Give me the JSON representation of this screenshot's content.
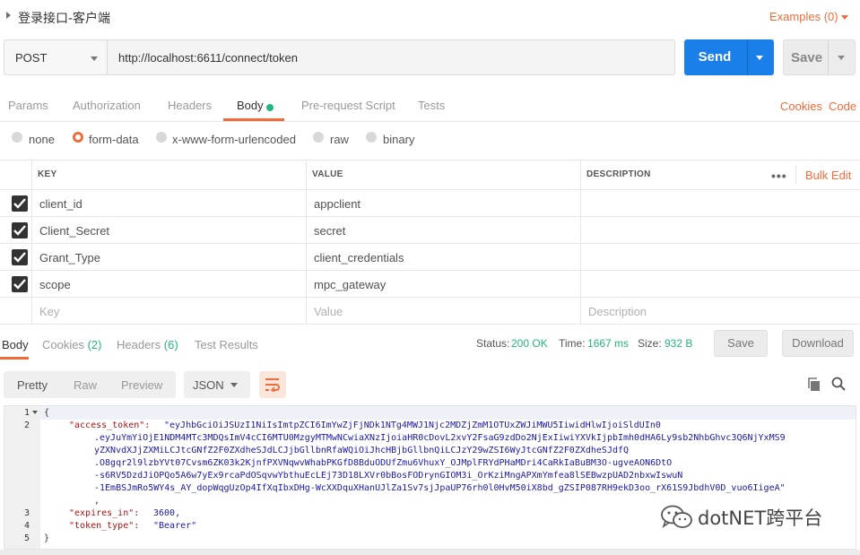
{
  "request": {
    "title": "登录接口-客户端",
    "examples_label": "Examples (0)",
    "method": "POST",
    "url": "http://localhost:6611/connect/token",
    "send_label": "Send",
    "save_label": "Save"
  },
  "tabs": {
    "items": [
      "Params",
      "Authorization",
      "Headers",
      "Body",
      "Pre-request Script",
      "Tests"
    ],
    "active": "Body",
    "cookies_label": "Cookies",
    "code_label": "Code"
  },
  "body_types": [
    "none",
    "form-data",
    "x-www-form-urlencoded",
    "raw",
    "binary"
  ],
  "body_type_selected": "form-data",
  "params_table": {
    "headers": [
      "KEY",
      "VALUE",
      "DESCRIPTION"
    ],
    "bulk_edit_label": "Bulk Edit",
    "rows": [
      {
        "key": "client_id",
        "value": "appclient",
        "checked": true
      },
      {
        "key": "Client_Secret",
        "value": "secret",
        "checked": true
      },
      {
        "key": "Grant_Type",
        "value": "client_credentials",
        "checked": true
      },
      {
        "key": "scope",
        "value": "mpc_gateway",
        "checked": true
      }
    ],
    "placeholder": {
      "key": "Key",
      "value": "Value",
      "description": "Description"
    }
  },
  "response": {
    "tabs": {
      "body": "Body",
      "cookies": "Cookies",
      "cookies_count": "(2)",
      "headers": "Headers",
      "headers_count": "(6)",
      "test_results": "Test Results"
    },
    "status_label": "Status:",
    "status_value": "200 OK",
    "time_label": "Time:",
    "time_value": "1667 ms",
    "size_label": "Size:",
    "size_value": "932 B",
    "save_label": "Save",
    "download_label": "Download",
    "view_modes": [
      "Pretty",
      "Raw",
      "Preview"
    ],
    "view_active": "Pretty",
    "format": "JSON",
    "code": {
      "line_numbers": [
        "1",
        "2",
        "3",
        "4",
        "5"
      ],
      "open_brace": "{",
      "close_brace": "}",
      "access_token_key": "\"access_token\":",
      "access_token_lines": [
        "\"eyJhbGciOiJSUzI1NiIsImtpZCI6ImYwZjFjNDk1NTg4MWJ1Njc2MDZjZmM1OTUxZWJiMWU5IiwidHlwIjoiSldUIn0",
        ".eyJuYmYiOjE1NDM4MTc3MDQsImV4cCI6MTU0MzgyMTMwNCwiaXNzIjoiaHR0cDovL2xvY2FsaG9zdDo2NjExIiwiYXVkIjpbImh0dHA6Ly9sb2NhbGhvc3Q6NjYxMS9",
        "yZXNvdXJjZXMiLCJtcGNfZ2F0ZXdheSJdLCJjbGllbnRfaWQiOiJhcHBjbGllbnQiLCJzY29wZSI6WyJtcGNfZ2F0ZXdheSJdfQ",
        ".O8gqr2l9lzbYVt07Cvsm6ZK03k2KjnfPXVNqwvWhabPKGfD8BduODUfZmu6VhuxY_OJMplFRYdPHaMDri4CaRkIaBuBM3O-ugveAON6DtO",
        "-s6RV5DzdJiOPQo5A6w7yEx9rcaPdOSqvwYbthuEcLEj73D18LXVr0bBosFODrynGIOM3i_OrKziMngAPXmYmfea8lSEBwzpUAD2nbxwIswuN",
        "-1EmBSJmRo5WY4s_AY_dopWqgUzOp4IfXqIbxDHg-WcXXDquXHanUJlZa1Sv7sjJpaUP76rh0l0HvM50iX8bd_gZSIP087RH9ekD3oo_rX61S9JbdhV0D_vuo6IigeA\""
      ],
      "comma": ",",
      "expires_in_key": "\"expires_in\":",
      "expires_in_value": "3600,",
      "token_type_key": "\"token_type\":",
      "token_type_value": "\"Bearer\""
    }
  },
  "watermark": "dotNET跨平台",
  "colors": {
    "accent": "#f26b3a",
    "send_blue": "#1a7fe8",
    "success_green": "#26b47f"
  }
}
